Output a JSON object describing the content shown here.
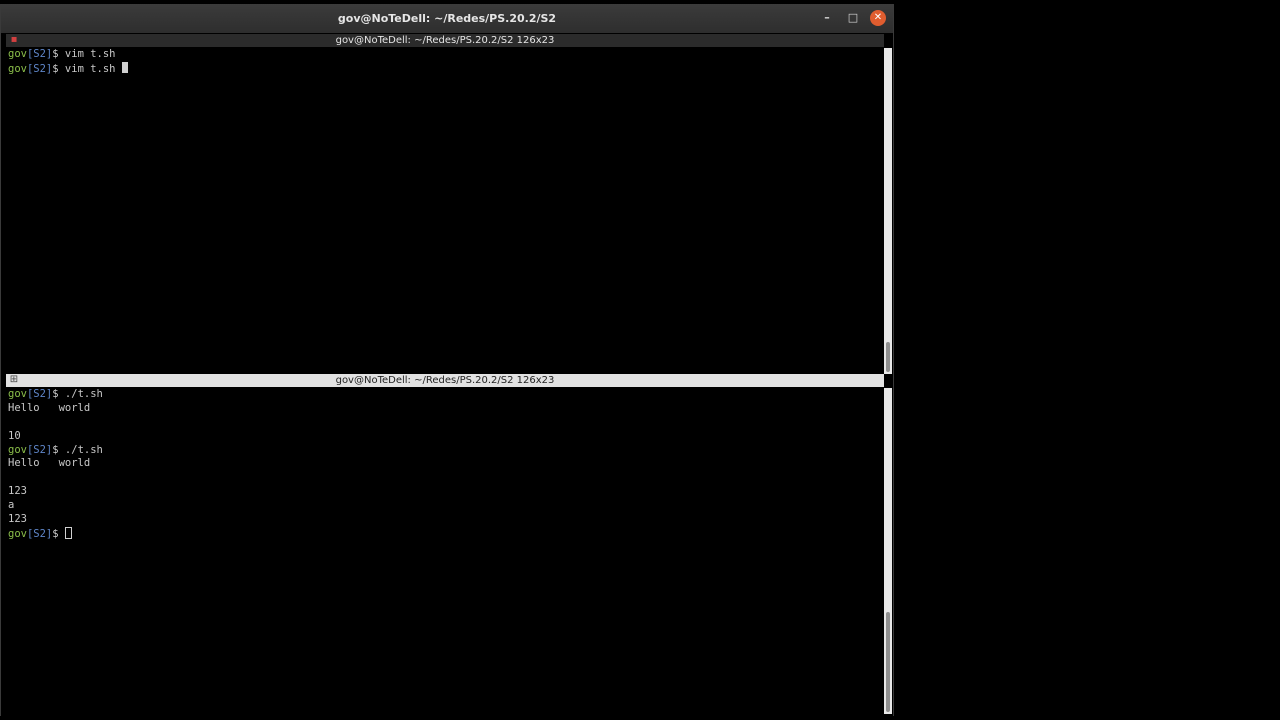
{
  "window": {
    "title": "gov@NoTeDell: ~/Redes/PS.20.2/S2",
    "minimize_glyph": "–",
    "maximize_glyph": "□",
    "close_glyph": "✕"
  },
  "top_pane": {
    "header": "gov@NoTeDell: ~/Redes/PS.20.2/S2 126x23",
    "icon": "terminal-split-icon",
    "lines": [
      {
        "user": "gov",
        "dir": "[S2]",
        "sym": "$ ",
        "cmd": "vim t.sh"
      },
      {
        "user": "gov",
        "dir": "[S2]",
        "sym": "$ ",
        "cmd": "vim t.sh "
      }
    ]
  },
  "bottom_pane": {
    "header": "gov@NoTeDell: ~/Redes/PS.20.2/S2 126x23",
    "icon": "terminal-split-icon",
    "lines": [
      {
        "user": "gov",
        "dir": "[S2]",
        "sym": "$ ",
        "cmd": "./t.sh"
      },
      {
        "text": "Hello   world"
      },
      {
        "text": ""
      },
      {
        "text": "10"
      },
      {
        "user": "gov",
        "dir": "[S2]",
        "sym": "$ ",
        "cmd": "./t.sh"
      },
      {
        "text": "Hello   world"
      },
      {
        "text": ""
      },
      {
        "text": "123"
      },
      {
        "text": "a"
      },
      {
        "text": "123"
      },
      {
        "user": "gov",
        "dir": "[S2]",
        "sym": "$ ",
        "cmd": ""
      }
    ]
  },
  "colors": {
    "prompt_user": "#8bbf4a",
    "prompt_dir": "#5f86c8",
    "close_button": "#e05d2f"
  }
}
